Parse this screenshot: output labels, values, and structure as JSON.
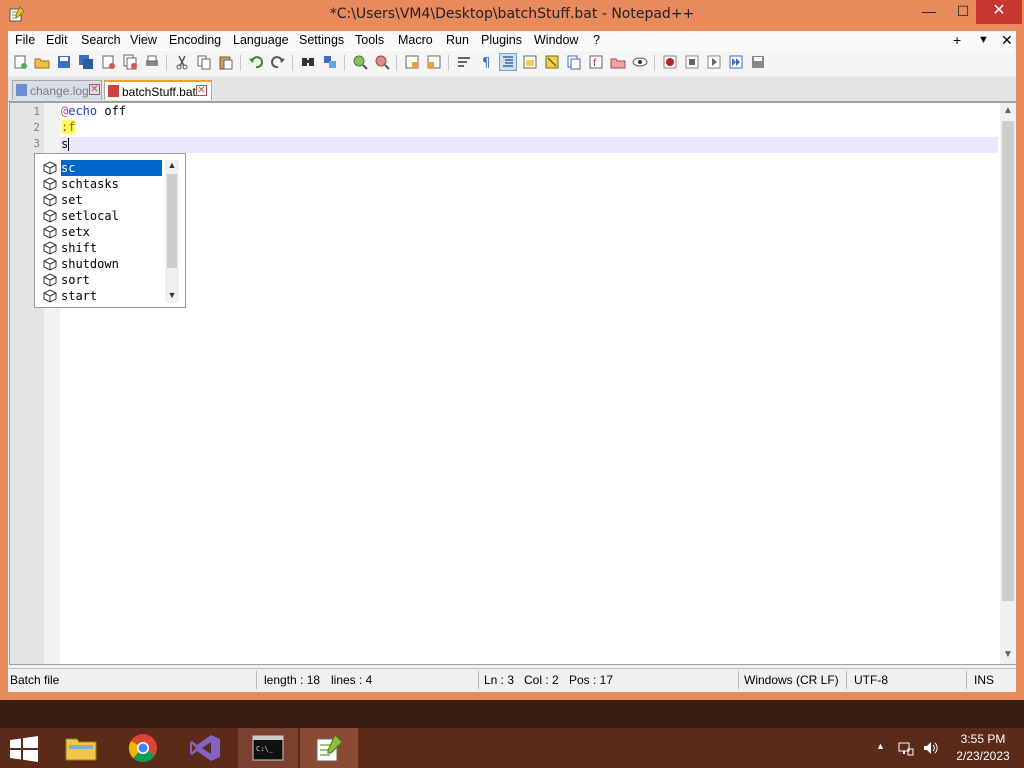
{
  "window": {
    "title": "*C:\\Users\\VM4\\Desktop\\batchStuff.bat - Notepad++",
    "min_glyph": "—",
    "max_glyph": "☐",
    "close_glyph": "✕"
  },
  "menu": {
    "items": [
      "File",
      "Edit",
      "Search",
      "View",
      "Encoding",
      "Language",
      "Settings",
      "Tools",
      "Macro",
      "Run",
      "Plugins",
      "Window",
      "?"
    ],
    "plus": "+",
    "dropdown": "▼",
    "close": "✕"
  },
  "tabs": [
    {
      "label": "change.log",
      "active": false
    },
    {
      "label": "batchStuff.bat",
      "active": true
    }
  ],
  "editor": {
    "line_numbers": [
      "1",
      "2",
      "3"
    ],
    "lines": {
      "l1_at": "@",
      "l1_kw": "echo",
      "l1_rest": " off",
      "l2": ":f",
      "l3": "s"
    }
  },
  "autocomplete": {
    "items": [
      "sc",
      "schtasks",
      "set",
      "setlocal",
      "setx",
      "shift",
      "shutdown",
      "sort",
      "start"
    ],
    "selected_index": 0
  },
  "status": {
    "language": "Batch file",
    "length": "length : 18",
    "lines": "lines : 4",
    "ln": "Ln : 3",
    "col": "Col : 2",
    "pos": "Pos : 17",
    "eol": "Windows (CR LF)",
    "encoding": "UTF-8",
    "mode": "INS"
  },
  "taskbar": {
    "time": "3:55 PM",
    "date": "2/23/2023"
  },
  "colors": {
    "window_frame": "#e98a5c",
    "taskbar": "#5c2a18",
    "selection": "#0066cc"
  }
}
